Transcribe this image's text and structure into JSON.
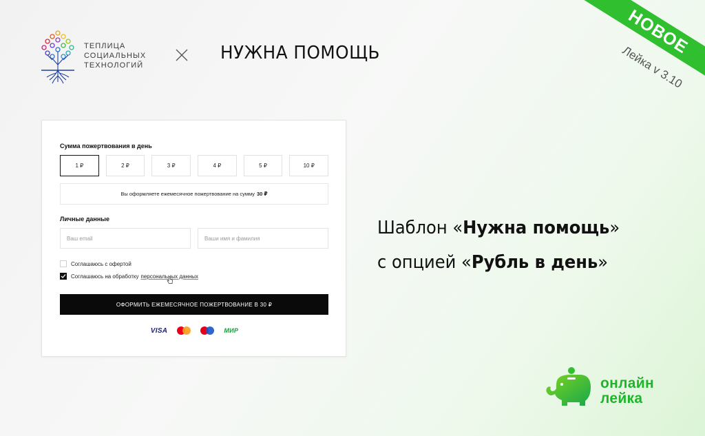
{
  "header": {
    "teplica_lines": [
      "ТЕПЛИЦА",
      "СОЦИАЛЬНЫХ",
      "ТЕХНОЛОГИЙ"
    ],
    "separator": "×",
    "partner_title": "НУЖНА ПОМОЩЬ"
  },
  "ribbon": {
    "label": "НОВОЕ",
    "version": "Лейка v 3.10",
    "color": "#2fbf2f"
  },
  "form": {
    "amount_label": "Сумма пожертвования в день",
    "amounts": [
      "1 ₽",
      "2 ₽",
      "3 ₽",
      "4 ₽",
      "5 ₽",
      "10 ₽"
    ],
    "selected_amount": "1 ₽",
    "summary_text": "Вы оформляете ежемесячное пожертвование на сумму",
    "summary_amount": "30 ₽",
    "personal_label": "Личные данные",
    "email_placeholder": "Ваш email",
    "name_placeholder": "Ваши имя и фамилия",
    "offer_consent": "Соглашаюсь с офертой",
    "personal_consent": "Соглашаюсь на обработку",
    "personal_consent_link": "персональных данных",
    "offer_checked": false,
    "personal_checked": true,
    "submit_label": "ОФОРМИТЬ ЕЖЕМЕСЯЧНОЕ ПОЖЕРТВОВАНИЕ В 30 ₽",
    "payment_methods": {
      "visa": "VISA",
      "mir": "МИР"
    }
  },
  "headline": {
    "line1_prefix": "Шаблон «",
    "line1_bold": "Нужна помощь",
    "line1_suffix": "»",
    "line2_prefix": "с опцией «",
    "line2_bold": "Рубль в день",
    "line2_suffix": "»"
  },
  "brand": {
    "line1": "онлайн",
    "line2": "лейка",
    "accent": "#1eb52b"
  }
}
